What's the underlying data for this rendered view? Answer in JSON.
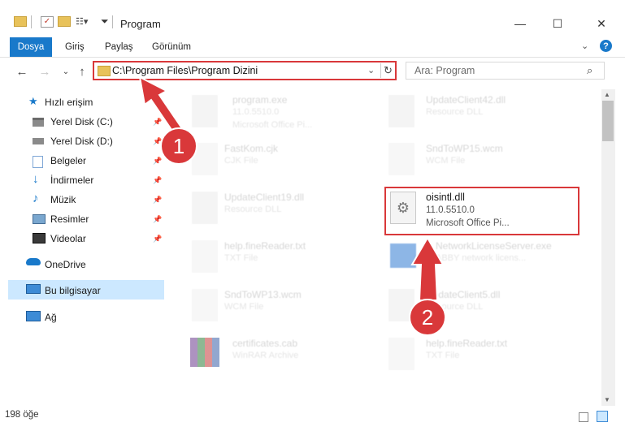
{
  "window": {
    "title": "Program",
    "btn_min": "—",
    "btn_max": "☐",
    "btn_close": "✕",
    "help": "?"
  },
  "ribbon": {
    "tabs": [
      "Dosya",
      "Giriş",
      "Paylaş",
      "Görünüm"
    ]
  },
  "address": {
    "path": "C:\\Program Files\\Program Dizini"
  },
  "search": {
    "placeholder": "Ara: Program"
  },
  "sidebar": {
    "items": [
      {
        "label": "Hızlı erişim"
      },
      {
        "label": "Yerel Disk (C:)"
      },
      {
        "label": "Yerel Disk (D:)"
      },
      {
        "label": "Belgeler"
      },
      {
        "label": "İndirmeler"
      },
      {
        "label": "Müzik"
      },
      {
        "label": "Resimler"
      },
      {
        "label": "Videolar"
      },
      {
        "label": "OneDrive"
      },
      {
        "label": "Bu bilgisayar"
      },
      {
        "label": "Ağ"
      }
    ]
  },
  "files": [
    {
      "name": "program.exe",
      "line2": "11.0.5510.0",
      "line3": "Microsoft Office Pi..."
    },
    {
      "name": "UpdateClient42.dll",
      "line2": "Resource DLL"
    },
    {
      "name": "FastKom.cjk",
      "line2": "CJK File"
    },
    {
      "name": "SndToWP15.wcm",
      "line2": "WCM File"
    },
    {
      "name": "UpdateClient19.dll",
      "line2": "Resource DLL"
    },
    {
      "name": "oisintl.dll",
      "line2": "11.0.5510.0",
      "line3": "Microsoft Office Pi..."
    },
    {
      "name": "help.fineReader.txt",
      "line2": "TXT File"
    },
    {
      "name": "NetworkLicenseServer.exe",
      "line2": "ABBY network licens..."
    },
    {
      "name": "SndToWP13.wcm",
      "line2": "WCM File"
    },
    {
      "name": "UpdateClient5.dll",
      "line2": "Resource DLL"
    },
    {
      "name": "certificates.cab",
      "line2": "WinRAR Archive"
    },
    {
      "name": "help.fineReader.txt",
      "line2": "TXT File"
    }
  ],
  "status": {
    "count": "198 öğe"
  },
  "annotations": {
    "one": "1",
    "two": "2"
  },
  "colors": {
    "accent": "#1979ca",
    "highlight": "#d9383a",
    "selection": "#cce8ff"
  }
}
